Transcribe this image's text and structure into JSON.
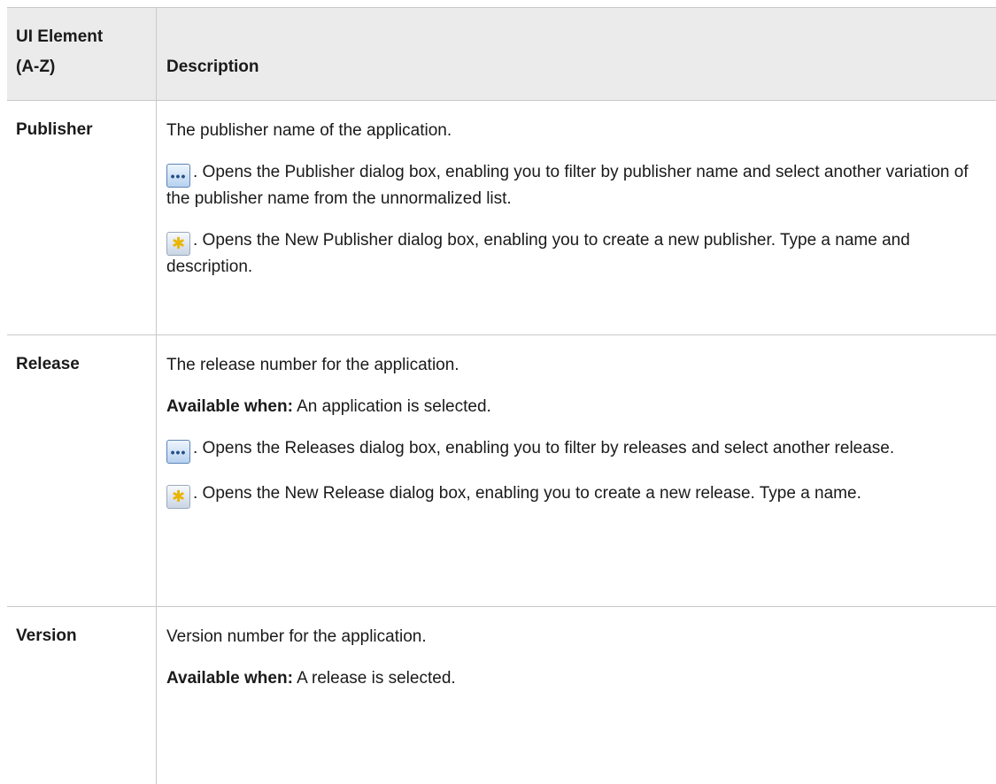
{
  "table": {
    "header": {
      "col1_line1": "UI Element",
      "col1_line2": "(A-Z)",
      "col2": "Description"
    },
    "rows": [
      {
        "name": "Publisher",
        "desc": "The publisher name of the application.",
        "browse_text": ". Opens the Publisher dialog box, enabling you to filter by publisher name and select another variation of the publisher name from the unnormalized list.",
        "new_text": ". Opens the New Publisher dialog box, enabling you to create a new publisher. Type a name and description."
      },
      {
        "name": "Release",
        "desc": "The release number for the application.",
        "avail_label": "Available when:",
        "avail_text": " An application is selected.",
        "browse_text": ". Opens the Releases dialog box, enabling you to filter by releases and select another release.",
        "new_text": ". Opens the New Release dialog box, enabling you to create a new release. Type a name."
      },
      {
        "name": "Version",
        "desc": "Version number for the application.",
        "avail_label": "Available when:",
        "avail_text": " A release is selected."
      }
    ]
  },
  "icons": {
    "browse": "ellipsis-button-icon",
    "new": "new-star-icon"
  }
}
